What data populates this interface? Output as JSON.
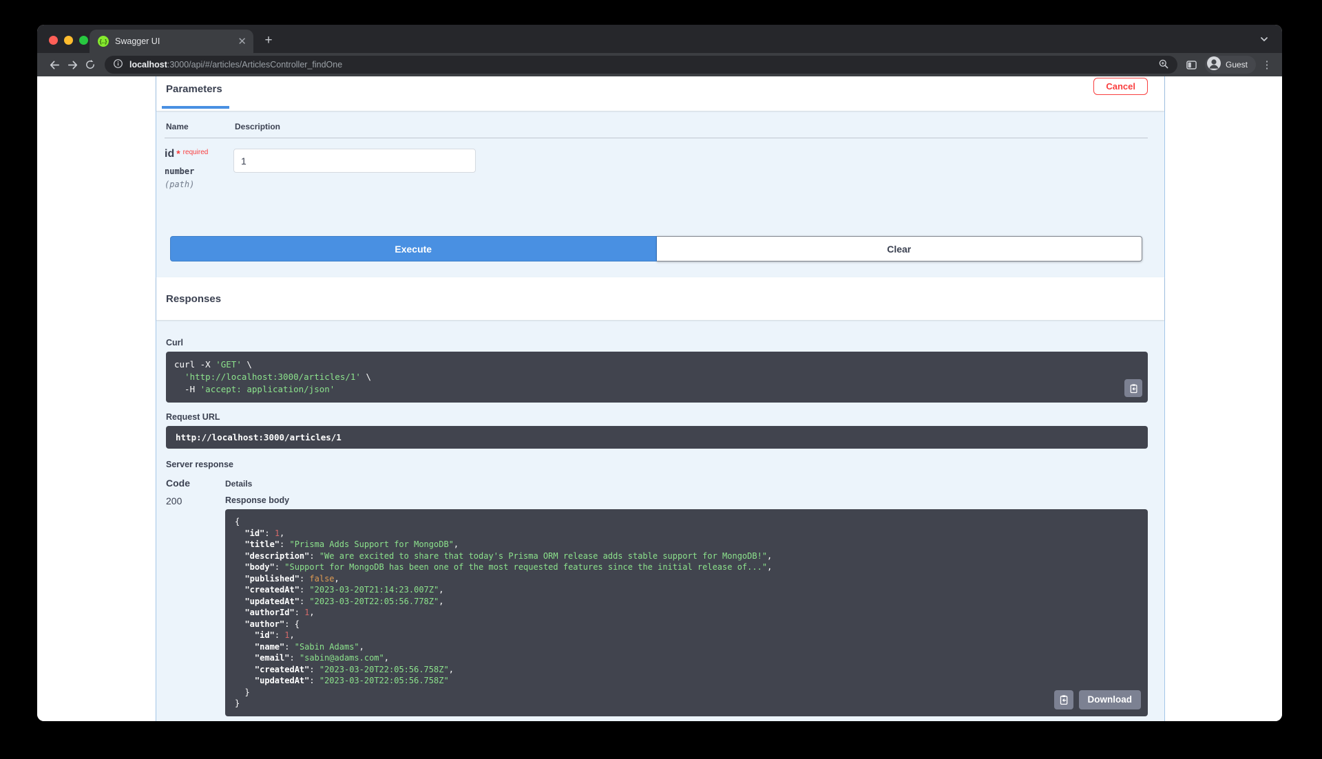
{
  "colors": {
    "accent_blue": "#4990e2",
    "cancel_red": "#f93e3e",
    "required_red": "#f93e3e",
    "code_bg": "#41444e",
    "code_string_green": "#8ce28c",
    "code_number_red": "#d36a6a",
    "code_bool_orange": "#de9b52",
    "opblock_bg": "#ecf4fb",
    "opblock_border": "#a4c6e8",
    "heading_text": "#3b4151",
    "gray_button": "#7c8192"
  },
  "browser": {
    "tab_title": "Swagger UI",
    "url_host": "localhost",
    "url_path": ":3000/api/#/articles/ArticlesController_findOne",
    "profile_label": "Guest"
  },
  "parameters_section": {
    "tab_label": "Parameters",
    "cancel_label": "Cancel",
    "columns": {
      "name": "Name",
      "description": "Description"
    },
    "parameter": {
      "name": "id",
      "required_star": "*",
      "required_label": "required",
      "type": "number",
      "location": "(path)",
      "value": "1"
    },
    "execute_label": "Execute",
    "clear_label": "Clear"
  },
  "responses_section": {
    "title": "Responses",
    "curl_label": "Curl",
    "curl_lines": [
      "curl -X 'GET' \\",
      "  'http://localhost:3000/articles/1' \\",
      "  -H 'accept: application/json'"
    ],
    "request_url_label": "Request URL",
    "request_url": "http://localhost:3000/articles/1",
    "server_response_label": "Server response",
    "columns": {
      "code": "Code",
      "details": "Details"
    },
    "status_code": "200",
    "response_body_label": "Response body",
    "response_body_lines": [
      "{",
      "  \"id\": 1,",
      "  \"title\": \"Prisma Adds Support for MongoDB\",",
      "  \"description\": \"We are excited to share that today's Prisma ORM release adds stable support for MongoDB!\",",
      "  \"body\": \"Support for MongoDB has been one of the most requested features since the initial release of...\",",
      "  \"published\": false,",
      "  \"createdAt\": \"2023-03-20T21:14:23.007Z\",",
      "  \"updatedAt\": \"2023-03-20T22:05:56.778Z\",",
      "  \"authorId\": 1,",
      "  \"author\": {",
      "    \"id\": 1,",
      "    \"name\": \"Sabin Adams\",",
      "    \"email\": \"sabin@adams.com\",",
      "    \"createdAt\": \"2023-03-20T22:05:56.758Z\",",
      "    \"updatedAt\": \"2023-03-20T22:05:56.758Z\"",
      "  }",
      "}"
    ],
    "download_label": "Download"
  }
}
